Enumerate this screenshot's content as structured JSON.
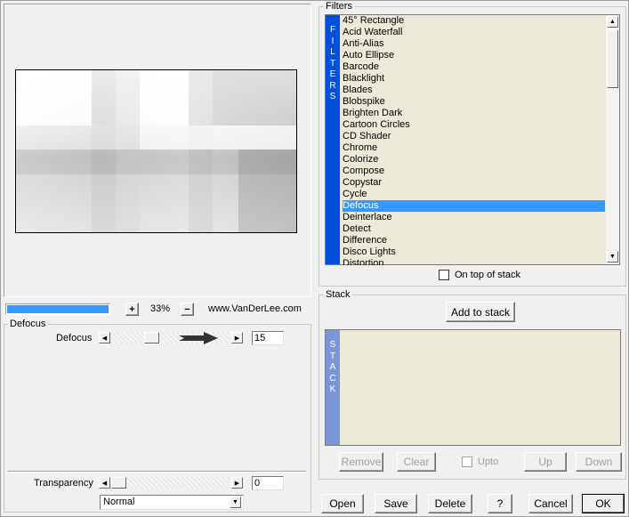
{
  "preview": {
    "zoom_plus": "+",
    "zoom_value": "33%",
    "zoom_minus": "−",
    "website": "www.VanDerLee.com"
  },
  "filter_panel": {
    "group_label": "Defocus",
    "param_label": "Defocus",
    "param_value": "15",
    "param_level": 0.3,
    "transparency_label": "Transparency",
    "transparency_value": "0",
    "transparency_level": 0.0,
    "blend_mode": "Normal"
  },
  "filters": {
    "group_label": "Filters",
    "side_label": [
      "F",
      "I",
      "L",
      "T",
      "E",
      "R",
      "S"
    ],
    "items": [
      "45° Rectangle",
      "Acid Waterfall",
      "Anti-Alias",
      "Auto Ellipse",
      "Barcode",
      "Blacklight",
      "Blades",
      "Blobspike",
      "Brighten Dark",
      "Cartoon Circles",
      "CD Shader",
      "Chrome",
      "Colorize",
      "Compose",
      "Copystar",
      "Cycle",
      "Defocus",
      "Deinterlace",
      "Detect",
      "Difference",
      "Disco Lights",
      "Distortion"
    ],
    "selected_index": 16,
    "on_top_label": "On top of stack"
  },
  "stack": {
    "group_label": "Stack",
    "add_label": "Add to stack",
    "side_label": [
      "S",
      "T",
      "A",
      "C",
      "K"
    ],
    "remove_label": "Remove",
    "clear_label": "Clear",
    "upto_label": "Upto",
    "up_label": "Up",
    "down_label": "Down"
  },
  "footer": {
    "open": "Open",
    "save": "Save",
    "delete": "Delete",
    "help": "?",
    "cancel": "Cancel",
    "ok": "OK"
  },
  "colors": {
    "accent": "#0050e0",
    "selection": "#3399ff",
    "list_bg": "#ece9d8",
    "stack_side": "#7b96d8"
  }
}
